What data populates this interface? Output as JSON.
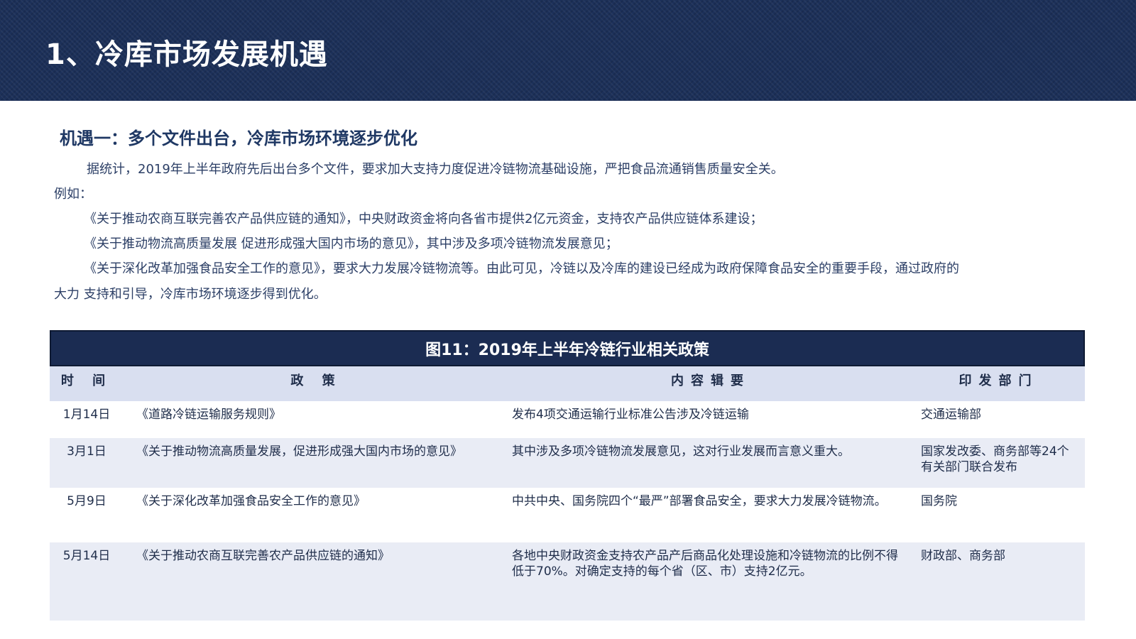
{
  "header": {
    "title": "1、冷库市场发展机遇"
  },
  "section": {
    "subheading": "机遇一：多个文件出台，冷库市场环境逐步优化",
    "lines": [
      "据统计，2019年上半年政府先后出台多个文件，要求加大支持力度促进冷链物流基础设施，严把食品流通销售质量安全关。",
      "例如：",
      "《关于推动农商互联完善农产品供应链的通知》，中央财政资金将向各省市提供2亿元资金，支持农产品供应链体系建设；",
      "《关于推动物流高质量发展 促进形成强大国内市场的意见》，其中涉及多项冷链物流发展意见；",
      "《关于深化改革加强食品安全工作的意见》，要求大力发展冷链物流等。由此可见，冷链以及冷库的建设已经成为政府保障食品安全的重要手段，通过政府的",
      "大力   支持和引导，冷库市场环境逐步得到优化。"
    ]
  },
  "table": {
    "title": "图11：2019年上半年冷链行业相关政策",
    "headers": [
      "时 间",
      "政 策",
      "内容辑要",
      "印发部门"
    ],
    "rows": [
      {
        "date": "1月14日",
        "policy": "《道路冷链运输服务规则》",
        "content": "发布4项交通运输行业标准公告涉及冷链运输",
        "dept": "交通运输部"
      },
      {
        "date": "3月1日",
        "policy": "《关于推动物流高质量发展，促进形成强大国内市场的意见》",
        "content": "其中涉及多项冷链物流发展意见，这对行业发展而言意义重大。",
        "dept": "国家发改委、商务部等24个有关部门联合发布"
      },
      {
        "date": "5月9日",
        "policy": "《关于深化改革加强食品安全工作的意见》",
        "content": "中共中央、国务院四个“最严”部署食品安全，要求大力发展冷链物流。",
        "dept": "国务院"
      },
      {
        "date": "5月14日",
        "policy": "《关于推动农商互联完善农产品供应链的通知》",
        "content": "各地中央财政资金支持农产品产后商品化处理设施和冷链物流的比例不得低于70%。对确定支持的每个省（区、市）支持2亿元。",
        "dept": "财政部、商务部"
      }
    ]
  }
}
